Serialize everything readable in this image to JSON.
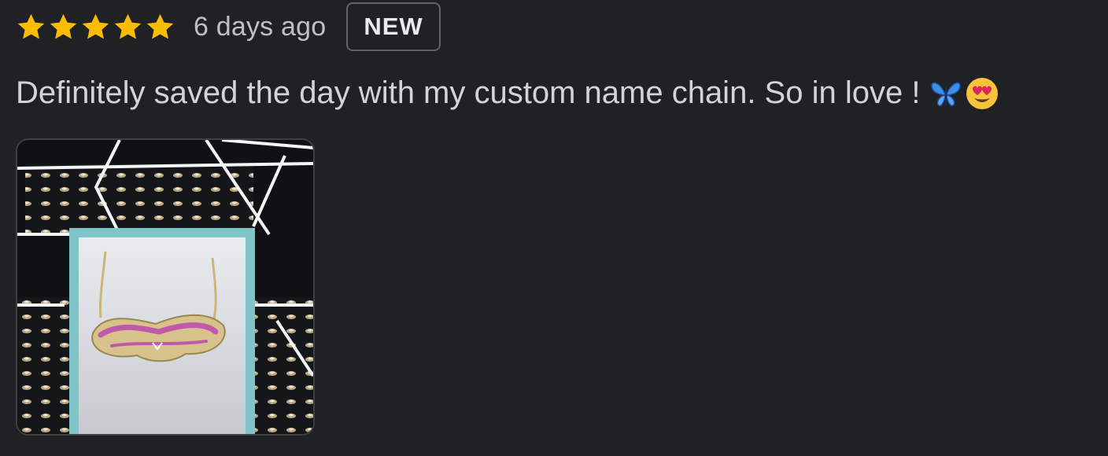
{
  "review": {
    "rating": 5,
    "rating_max": 5,
    "time_ago": "6 days ago",
    "badge": "NEW",
    "text": "Definitely saved the day with my custom name chain. So in love !",
    "emojis": [
      "butterfly",
      "heart-eyes-face"
    ],
    "photo": {
      "pendant_text": "Name chain"
    }
  },
  "colors": {
    "background": "#202124",
    "star": "#fbbc04",
    "text": "#d3d4d6",
    "muted_text": "#bdc1c6",
    "badge_border": "#5f6368",
    "box_teal": "#7ec4c8",
    "pendant_pink": "#c05aa8",
    "gold": "#d8c28c"
  }
}
